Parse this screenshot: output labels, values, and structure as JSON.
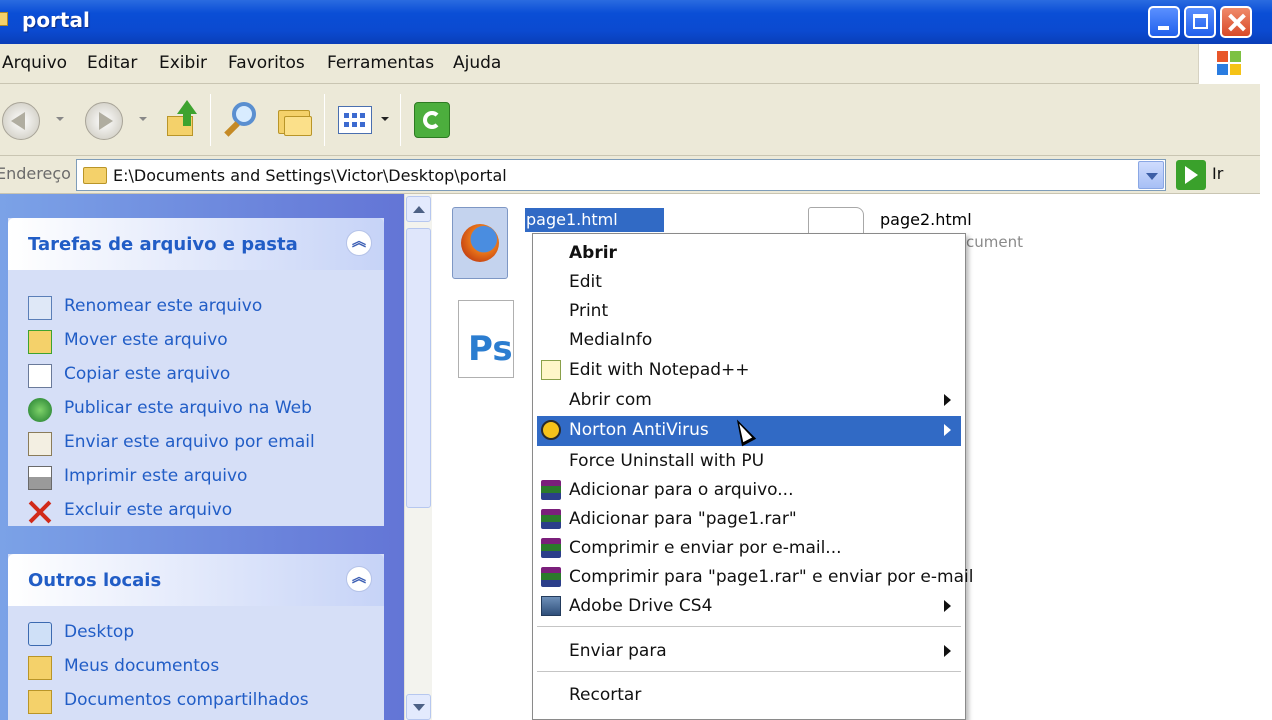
{
  "window": {
    "title": "portal"
  },
  "menubar": {
    "items": [
      "Arquivo",
      "Editar",
      "Exibir",
      "Favoritos",
      "Ferramentas",
      "Ajuda"
    ]
  },
  "toolbar": {
    "buttons": [
      "back-icon",
      "forward-icon",
      "up-folder-icon",
      "search-icon",
      "folders-icon",
      "views-icon",
      "sync-icon"
    ]
  },
  "address": {
    "label": "Endereço",
    "path": "E:\\Documents and Settings\\Victor\\Desktop\\portal",
    "go_label": "Ir"
  },
  "task_pane": {
    "file_tasks": {
      "title": "Tarefas de arquivo e pasta",
      "items": [
        {
          "label": "Renomear este arquivo",
          "icon": "rename-icon"
        },
        {
          "label": "Mover este arquivo",
          "icon": "move-icon"
        },
        {
          "label": "Copiar este arquivo",
          "icon": "copy-icon"
        },
        {
          "label": "Publicar este arquivo na Web",
          "icon": "publish-web-icon"
        },
        {
          "label": "Enviar este arquivo por email",
          "icon": "email-icon"
        },
        {
          "label": "Imprimir este arquivo",
          "icon": "print-icon"
        },
        {
          "label": "Excluir este arquivo",
          "icon": "delete-icon"
        }
      ]
    },
    "other_places": {
      "title": "Outros locais",
      "items": [
        {
          "label": "Desktop",
          "icon": "desktop-icon"
        },
        {
          "label": "Meus documentos",
          "icon": "my-documents-icon"
        },
        {
          "label": "Documentos compartilhados",
          "icon": "shared-folder-icon"
        }
      ]
    }
  },
  "files": [
    {
      "name": "page1.html",
      "type": "firefox-html-icon",
      "selected": true
    },
    {
      "name": "page2.html",
      "sub": "cument",
      "type": "html-document-icon"
    },
    {
      "name": "",
      "type": "photoshop-file-icon"
    }
  ],
  "context_menu": {
    "items": [
      {
        "label": "Abrir",
        "bold": true
      },
      {
        "label": "Edit"
      },
      {
        "label": "Print"
      },
      {
        "label": "MediaInfo"
      },
      {
        "label": "Edit with Notepad++",
        "icon": "notepadpp-icon"
      },
      {
        "label": "Abrir com",
        "submenu": true
      },
      {
        "label": "Norton AntiVirus",
        "icon": "norton-icon",
        "submenu": true,
        "highlighted": true
      },
      {
        "label": "Force Uninstall with PU"
      },
      {
        "label": "Adicionar para o arquivo...",
        "icon": "winrar-icon"
      },
      {
        "label": "Adicionar para \"page1.rar\"",
        "icon": "winrar-icon"
      },
      {
        "label": "Comprimir e enviar por e-mail...",
        "icon": "winrar-icon"
      },
      {
        "label": "Comprimir para \"page1.rar\" e enviar por e-mail",
        "icon": "winrar-icon"
      },
      {
        "label": "Adobe Drive CS4",
        "icon": "adobe-drive-icon",
        "submenu": true
      },
      {
        "label": "Enviar para",
        "submenu": true
      },
      {
        "label": "Recortar"
      }
    ]
  },
  "colors": {
    "title_bar": "#0a4ed6",
    "task_pane_link": "#215dc6",
    "highlight": "#316ac5"
  }
}
